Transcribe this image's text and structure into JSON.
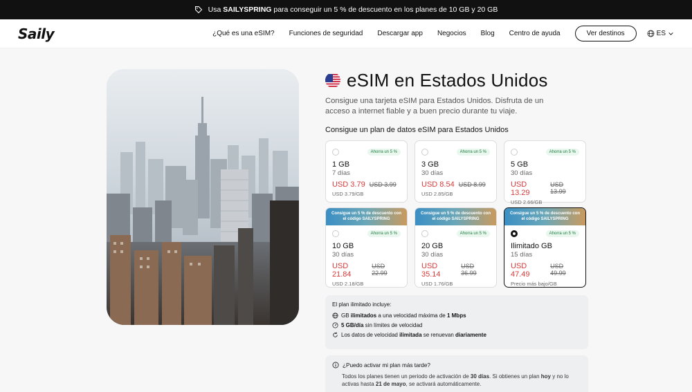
{
  "promo": {
    "prefix": "Usa ",
    "code": "SAILYSPRING",
    "suffix": " para conseguir un 5 % de descuento en los planes de 10 GB y 20 GB"
  },
  "nav": {
    "logo": "Saily",
    "links": [
      "¿Qué es una eSIM?",
      "Funciones de seguridad",
      "Descargar app",
      "Negocios",
      "Blog",
      "Centro de ayuda"
    ],
    "cta": "Ver destinos",
    "lang": "ES"
  },
  "hero": {
    "title": "eSIM en Estados Unidos",
    "description": "Consigue una tarjeta eSIM para Estados Unidos. Disfruta de un acceso a internet fiable y a buen precio durante tu viaje.",
    "plans_heading": "Consigue un plan de datos eSIM para Estados Unidos"
  },
  "plans": [
    {
      "size": "1 GB",
      "days": "7 días",
      "price": "USD 3.79",
      "old": "USD 3.99",
      "per": "USD 3.79/GB",
      "badge": "Ahorra un 5 %",
      "promo": "",
      "selected": false
    },
    {
      "size": "3 GB",
      "days": "30 días",
      "price": "USD 8.54",
      "old": "USD 8.99",
      "per": "USD 2.85/GB",
      "badge": "Ahorra un 5 %",
      "promo": "",
      "selected": false
    },
    {
      "size": "5 GB",
      "days": "30 días",
      "price": "USD 13.29",
      "old": "USD 13.99",
      "per": "USD 2.66/GB",
      "badge": "Ahorra un 5 %",
      "promo": "",
      "selected": false
    },
    {
      "size": "10 GB",
      "days": "30 días",
      "price": "USD 21.84",
      "old": "USD 22.99",
      "per": "USD 2.18/GB",
      "badge": "Ahorra un 5 %",
      "promo": "Consigue un 5 % de descuento con el código SAILYSPRING",
      "selected": false
    },
    {
      "size": "20 GB",
      "days": "30 días",
      "price": "USD 35.14",
      "old": "USD 36.99",
      "per": "USD 1.76/GB",
      "badge": "Ahorra un 5 %",
      "promo": "Consigue un 5 % de descuento con el código SAILYSPRING",
      "selected": false
    },
    {
      "size": "Ilimitado GB",
      "days": "15 días",
      "price": "USD 47.49",
      "old": "USD 49.99",
      "per": "Precio más bajo/GB",
      "badge": "Ahorra un 5 %",
      "promo": "Consigue un 5 % de descuento con el código SAILYSPRING",
      "selected": true
    }
  ],
  "unlimited": {
    "title": "El plan ilimitado incluye:",
    "row1": {
      "a": "GB ",
      "b": "ilimitados",
      "c": " a una velocidad máxima de ",
      "d": "1 Mbps"
    },
    "row2": {
      "a": "5 GB/día",
      "b": " sin límites de velocidad"
    },
    "row3": {
      "a": "Los datos de velocidad ",
      "b": "ilimitada",
      "c": " se renuevan ",
      "d": "diariamente"
    }
  },
  "faq": {
    "question": "¿Puedo activar mi plan más tarde?",
    "p1": "Todos los planes tienen un periodo de activación de ",
    "b1": "30 días",
    "p2": ". Si obtienes un plan ",
    "b2": "hoy",
    "p3": " y no lo activas hasta ",
    "b3": "21 de mayo",
    "p4": ", se activará automáticamente."
  },
  "colors": {
    "accent_red": "#d83a3a",
    "badge_green": "#1c7a3e",
    "dark": "#111111"
  }
}
